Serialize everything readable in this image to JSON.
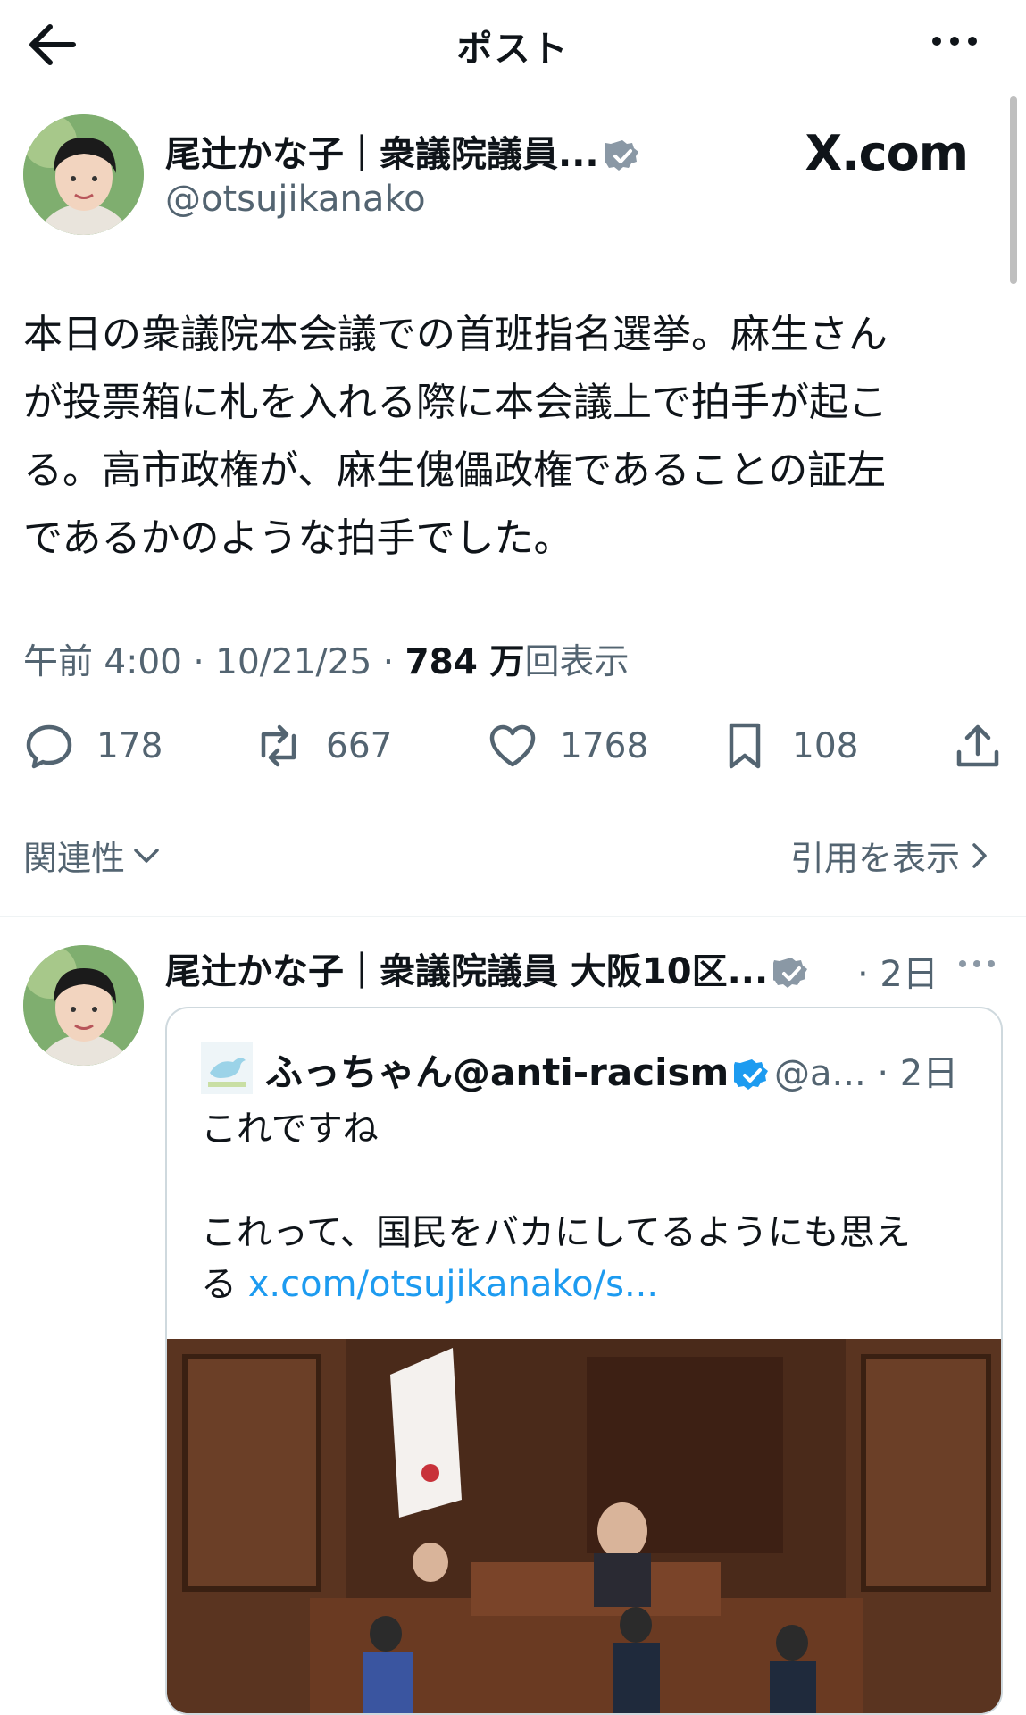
{
  "header": {
    "title": "ポスト"
  },
  "author": {
    "name": "尾辻かな子｜衆議院議員...",
    "handle": "@otsujikanako",
    "watermark": "X.com"
  },
  "tweet": {
    "text": "本日の衆議院本会議での首班指名選挙。麻生さん\nが投票箱に札を入れる際に本会議上で拍手が起こ\nる。高市政権が、麻生傀儡政権であることの証左\nであるかのような拍手でした。",
    "time": "午前 4:00 · 10/21/25 · ",
    "views_count": "784 万",
    "views_label": "回表示"
  },
  "actions": {
    "replies": "178",
    "reposts": "667",
    "likes": "1768",
    "bookmarks": "108"
  },
  "related_label": "関連性",
  "quotes_label": "引用を表示",
  "reply": {
    "name": "尾辻かな子｜衆議院議員 大阪10区...",
    "time": "· 2日",
    "quoted": {
      "name": "ふっちゃん@anti-racism",
      "handle": "@a... · 2日",
      "text_line1": "これですね",
      "text_line2": "これって、国民をバカにしてるようにも思え\nる ",
      "link": "x.com/otsujikanako/s..."
    }
  },
  "colors": {
    "accent": "#1d9bf0",
    "verified": "#1d9bf0",
    "muted": "#536471"
  }
}
